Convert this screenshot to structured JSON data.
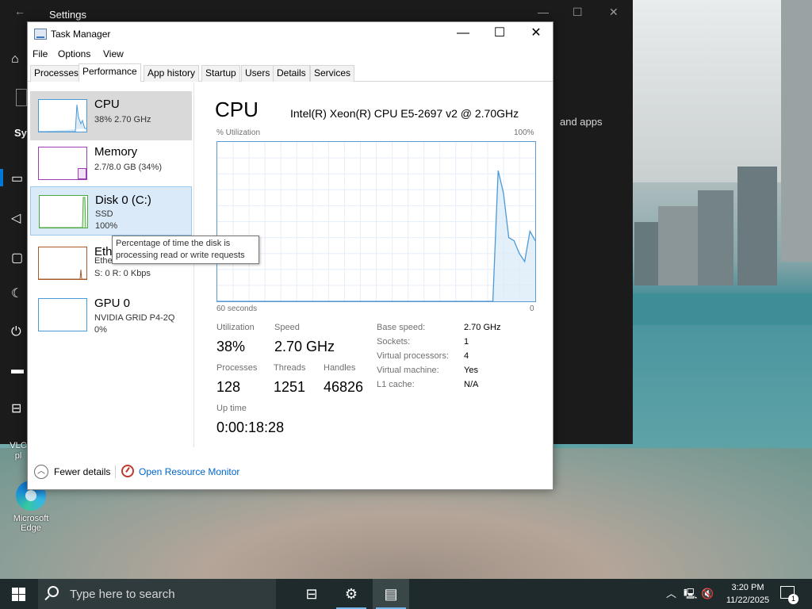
{
  "settings_window": {
    "title": "Settings",
    "partial_text": "and apps",
    "side_label": "Sy"
  },
  "desktop": {
    "vlc_label": "VLC pl",
    "edge_label": "Microsoft Edge"
  },
  "task_manager": {
    "title": "Task Manager",
    "menu": [
      "File",
      "Options",
      "View"
    ],
    "tabs": [
      "Processes",
      "Performance",
      "App history",
      "Startup",
      "Users",
      "Details",
      "Services"
    ],
    "active_tab": "Performance",
    "resources": [
      {
        "name": "CPU",
        "sub1": "38%  2.70 GHz",
        "color": "#4b9ad8"
      },
      {
        "name": "Memory",
        "sub1": "2.7/8.0 GB (34%)",
        "color": "#9b3fb5"
      },
      {
        "name": "Disk 0 (C:)",
        "sub1": "SSD",
        "sub2": "100%",
        "color": "#4da63f"
      },
      {
        "name": "Eth",
        "sub1": "Ethernet",
        "sub2": "S: 0  R: 0 Kbps",
        "color": "#a7592c"
      },
      {
        "name": "GPU 0",
        "sub1": "NVIDIA GRID P4-2Q",
        "sub2": "0%",
        "color": "#4b9ad8"
      }
    ],
    "tooltip": "Percentage of time the disk is processing read or write requests",
    "main": {
      "heading": "CPU",
      "model": "Intel(R) Xeon(R) CPU E5-2697 v2 @ 2.70GHz",
      "graph_top_left": "% Utilization",
      "graph_top_right": "100%",
      "graph_bottom_left": "60 seconds",
      "graph_bottom_right": "0"
    },
    "stats": {
      "utilization_label": "Utilization",
      "utilization": "38%",
      "speed_label": "Speed",
      "speed": "2.70 GHz",
      "processes_label": "Processes",
      "processes": "128",
      "threads_label": "Threads",
      "threads": "1251",
      "handles_label": "Handles",
      "handles": "46826",
      "uptime_label": "Up time",
      "uptime": "0:00:18:28"
    },
    "specs": [
      {
        "label": "Base speed:",
        "value": "2.70 GHz"
      },
      {
        "label": "Sockets:",
        "value": "1"
      },
      {
        "label": "Virtual processors:",
        "value": "4"
      },
      {
        "label": "Virtual machine:",
        "value": "Yes"
      },
      {
        "label": "L1 cache:",
        "value": "N/A"
      }
    ],
    "footer": {
      "fewer_details": "Fewer details",
      "resource_monitor": "Open Resource Monitor"
    }
  },
  "taskbar": {
    "search_placeholder": "Type here to search",
    "time": "3:20 PM",
    "date": "11/22/2025",
    "notification_count": "1"
  },
  "chart_data": {
    "type": "area",
    "ylim": [
      0,
      100
    ],
    "xlim": [
      60,
      0
    ],
    "x": [
      60,
      8,
      7,
      6,
      5,
      4,
      3,
      2,
      1,
      0
    ],
    "values": [
      0,
      0,
      82,
      68,
      40,
      38,
      30,
      25,
      44,
      38
    ],
    "xlabel": "60 seconds",
    "ylabel": "% Utilization",
    "grid": true
  }
}
